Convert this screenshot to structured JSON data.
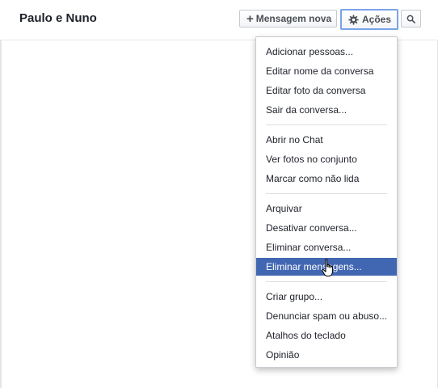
{
  "header": {
    "title": "Paulo e Nuno",
    "new_message_label": "Mensagem nova",
    "actions_label": "Ações"
  },
  "icons": {
    "plus": "+",
    "gear": "gear-icon",
    "search": "search-icon",
    "cursor": "hand-pointer-icon"
  },
  "menu": {
    "items": [
      "Adicionar pessoas...",
      "Editar nome da conversa",
      "Editar foto da conversa",
      "Sair da conversa...",
      "Abrir no Chat",
      "Ver fotos no conjunto",
      "Marcar como não lida",
      "Arquivar",
      "Desativar conversa...",
      "Eliminar conversa...",
      "Eliminar mensagens...",
      "Criar grupo...",
      "Denunciar spam ou abuso...",
      "Atalhos do teclado",
      "Opinião"
    ],
    "highlighted_item": "Eliminar mensagens..."
  },
  "colors": {
    "highlight": "#4267b2",
    "actions_focus_border": "#7aa3e6",
    "text": "#1d2129"
  }
}
